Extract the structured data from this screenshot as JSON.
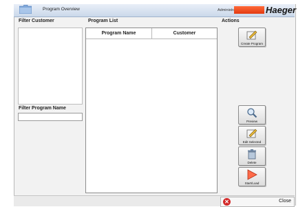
{
  "window": {
    "title": "Program Overview",
    "user": "Administrator",
    "brand": "Haeger"
  },
  "panels": {
    "filter_customer": "Filter Customer",
    "program_list": "Program List",
    "actions": "Actions",
    "filter_program_name": "Filter Program Name"
  },
  "filter_program_name": {
    "value": ""
  },
  "table": {
    "columns": [
      "Program Name",
      "Customer"
    ],
    "rows": []
  },
  "actions": {
    "create": "Create Program",
    "preview": "Preview",
    "edit": "Edit Selected",
    "delete": "Delete",
    "start": "Start/Load"
  },
  "footer": {
    "close": "Close"
  },
  "colors": {
    "brand_accent": "#e8461a",
    "titlebar": "#d6e1f0",
    "close_icon": "#d32a2a"
  }
}
